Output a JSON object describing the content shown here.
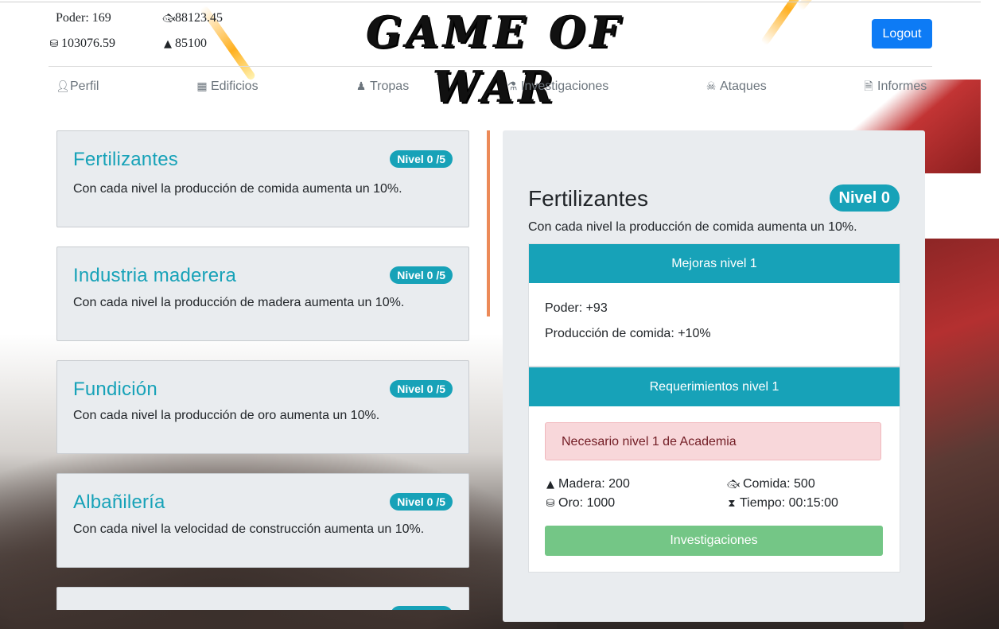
{
  "header": {
    "logo_text": "GAME OF WAR",
    "stats": {
      "power_label": "Poder: 169",
      "food_value": "88123.45",
      "gold_value": "103076.59",
      "wood_value": "85100"
    },
    "logout_label": "Logout"
  },
  "nav": {
    "items": [
      {
        "label": "Perfil",
        "icon": "user-icon"
      },
      {
        "label": "Edificios",
        "icon": "building-icon"
      },
      {
        "label": "Tropas",
        "icon": "soldier-icon"
      },
      {
        "label": "Investigaciones",
        "icon": "flask-icon"
      },
      {
        "label": "Ataques",
        "icon": "ninja-icon"
      },
      {
        "label": "Informes",
        "icon": "file-icon"
      }
    ]
  },
  "research_list": [
    {
      "title": "Fertilizantes",
      "level": "Nivel 0 /5",
      "description": "Con cada nivel la producción de comida aumenta un 10%."
    },
    {
      "title": "Industria maderera",
      "level": "Nivel 0 /5",
      "description": "Con cada nivel la producción de madera aumenta un 10%."
    },
    {
      "title": "Fundición",
      "level": "Nivel 0 /5",
      "description": "Con cada nivel la producción de oro aumenta un 10%."
    },
    {
      "title": "Albañilería",
      "level": "Nivel 0 /5",
      "description": "Con cada nivel la velocidad de construcción aumenta un 10%."
    }
  ],
  "detail": {
    "title": "Fertilizantes",
    "level": "Nivel 0",
    "description": "Con cada nivel la producción de comida aumenta un 10%.",
    "improvements": {
      "header": "Mejoras nivel 1",
      "power": "Poder: +93",
      "production": "Producción de comida: +10%"
    },
    "requirements": {
      "header": "Requerimientos nivel 1",
      "alert": "Necesario nivel 1 de Academia",
      "wood": "Madera: 200",
      "food": "Comida: 500",
      "gold": "Oro: 1000",
      "time": "Tiempo: 00:15:00"
    },
    "research_button": "Investigaciones"
  },
  "colors": {
    "accent": "#17a2b8",
    "logout": "#0d7bf5",
    "research_button": "#74c686",
    "alert_bg": "#f8d7da",
    "scroll_thumb": "#ec8a58"
  }
}
